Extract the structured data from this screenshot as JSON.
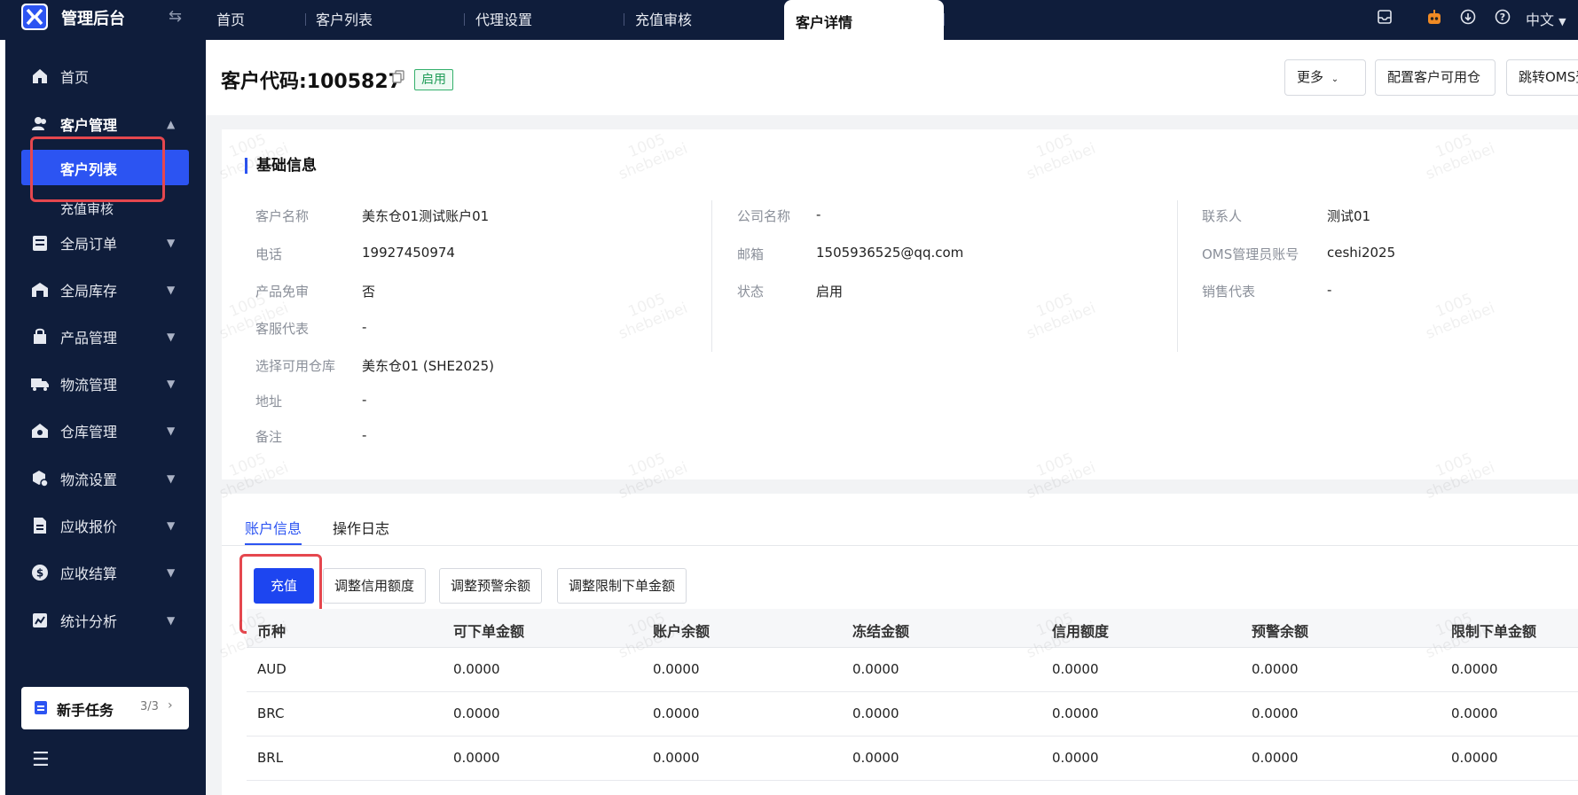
{
  "app": {
    "title": "管理后台"
  },
  "top_tabs": [
    {
      "label": "首页"
    },
    {
      "label": "客户列表"
    },
    {
      "label": "代理设置"
    },
    {
      "label": "充值审核"
    },
    {
      "label": "客户详情",
      "active": true
    }
  ],
  "top_right": {
    "language": "中文"
  },
  "sidebar": {
    "items": [
      {
        "label": "首页",
        "icon": "home-icon"
      },
      {
        "label": "客户管理",
        "icon": "users-icon",
        "expanded": true
      },
      {
        "label": "全局订单",
        "icon": "order-icon"
      },
      {
        "label": "全局库存",
        "icon": "warehouse-icon"
      },
      {
        "label": "产品管理",
        "icon": "product-icon"
      },
      {
        "label": "物流管理",
        "icon": "truck-icon"
      },
      {
        "label": "仓库管理",
        "icon": "house-icon"
      },
      {
        "label": "物流设置",
        "icon": "box-settings-icon"
      },
      {
        "label": "应收报价",
        "icon": "document-icon"
      },
      {
        "label": "应收结算",
        "icon": "dollar-icon"
      },
      {
        "label": "统计分析",
        "icon": "chart-icon"
      }
    ],
    "sub_items": [
      {
        "label": "客户列表",
        "active": true
      },
      {
        "label": "充值审核"
      }
    ],
    "task": {
      "label": "新手任务",
      "count": "3/3"
    }
  },
  "header": {
    "title": "客户代码:1005827",
    "status_badge": "启用",
    "buttons": {
      "more": "更多",
      "config": "配置客户可用仓",
      "jump": "跳转OMS登"
    }
  },
  "basic_info": {
    "title": "基础信息",
    "col1": [
      {
        "label": "客户名称",
        "value": "美东仓01测试账户01"
      },
      {
        "label": "电话",
        "value": "19927450974"
      },
      {
        "label": "产品免审",
        "value": "否"
      },
      {
        "label": "客服代表",
        "value": "-"
      },
      {
        "label": "选择可用仓库",
        "value": "美东仓01 (SHE2025)"
      },
      {
        "label": "地址",
        "value": "-"
      },
      {
        "label": "备注",
        "value": "-"
      }
    ],
    "col2": [
      {
        "label": "公司名称",
        "value": "-"
      },
      {
        "label": "邮箱",
        "value": "1505936525@qq.com"
      },
      {
        "label": "状态",
        "value": "启用"
      }
    ],
    "col3": [
      {
        "label": "联系人",
        "value": "测试01"
      },
      {
        "label": "OMS管理员账号",
        "value": "ceshi2025"
      },
      {
        "label": "销售代表",
        "value": "-"
      }
    ]
  },
  "account": {
    "tabs": [
      {
        "label": "账户信息",
        "active": true
      },
      {
        "label": "操作日志"
      }
    ],
    "actions": {
      "recharge": "充值",
      "credit": "调整信用额度",
      "warning": "调整预警余额",
      "limit": "调整限制下单金额"
    },
    "columns": [
      "币种",
      "可下单金额",
      "账户余额",
      "冻结金额",
      "信用额度",
      "预警余额",
      "限制下单金额"
    ],
    "rows": [
      [
        "AUD",
        "0.0000",
        "0.0000",
        "0.0000",
        "0.0000",
        "0.0000",
        "0.0000"
      ],
      [
        "BRC",
        "0.0000",
        "0.0000",
        "0.0000",
        "0.0000",
        "0.0000",
        "0.0000"
      ],
      [
        "BRL",
        "0.0000",
        "0.0000",
        "0.0000",
        "0.0000",
        "0.0000",
        "0.0000"
      ]
    ]
  },
  "watermark": {
    "line1": "1005",
    "line2": "shebeibei"
  }
}
